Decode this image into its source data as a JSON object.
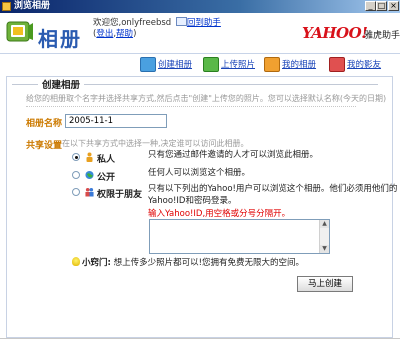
{
  "window": {
    "title": "浏览相册",
    "minimize": "_",
    "maximize": "□",
    "close": "×"
  },
  "header": {
    "brand": "相册",
    "welcome_prefix": "欢迎您,",
    "username": "onlyfreebsd",
    "back_link": "回到助手",
    "open_paren": "(",
    "logout": "登出",
    "comma": ",",
    "help": "帮助",
    "close_paren": ")",
    "yahoo_logo": "YAHOO!",
    "yahoo_sub": "雅虎助手"
  },
  "toolbar": {
    "items": [
      {
        "label": "创建相册",
        "icon": "create-album-icon"
      },
      {
        "label": "上传照片",
        "icon": "upload-photo-icon"
      },
      {
        "label": "我的相册",
        "icon": "my-album-icon"
      },
      {
        "label": "我的影友",
        "icon": "my-friends-icon"
      }
    ]
  },
  "form": {
    "legend": "创建相册",
    "description": "给您的相册取个名字并选择共享方式,然后点击\"创建\"上传您的照片。您可以选择默认名称(今天的日期)",
    "name_label": "相册名称",
    "name_value": "2005-11-1",
    "share_label": "共享设置",
    "share_hint": "在以下共享方式中选择一种,决定谁可以访问此相册。",
    "options": [
      {
        "label": "私人",
        "desc": "只有您通过邮件邀请的人才可以浏览此相册。",
        "selected": true
      },
      {
        "label": "公开",
        "desc": "任何人可以浏览这个相册。",
        "selected": false
      },
      {
        "label": "权限于朋友",
        "desc_line1": "只有以下列出的Yahoo!用户可以浏览这个相册。他们必须用他们的",
        "desc_line2": "Yahoo!ID和密码登录。",
        "warn": "输入Yahoo!ID,用空格或分号分隔开。",
        "selected": false
      }
    ],
    "tip_label": "小窍门:",
    "tip_text": "想上传多少照片都可以!您拥有免费无限大的空间。",
    "create_button": "马上创建"
  },
  "colors": {
    "accent": "#2a5bb0",
    "label_orange": "#cc7a00",
    "warn_red": "#e00000",
    "yahoo_red": "#d8111a"
  }
}
